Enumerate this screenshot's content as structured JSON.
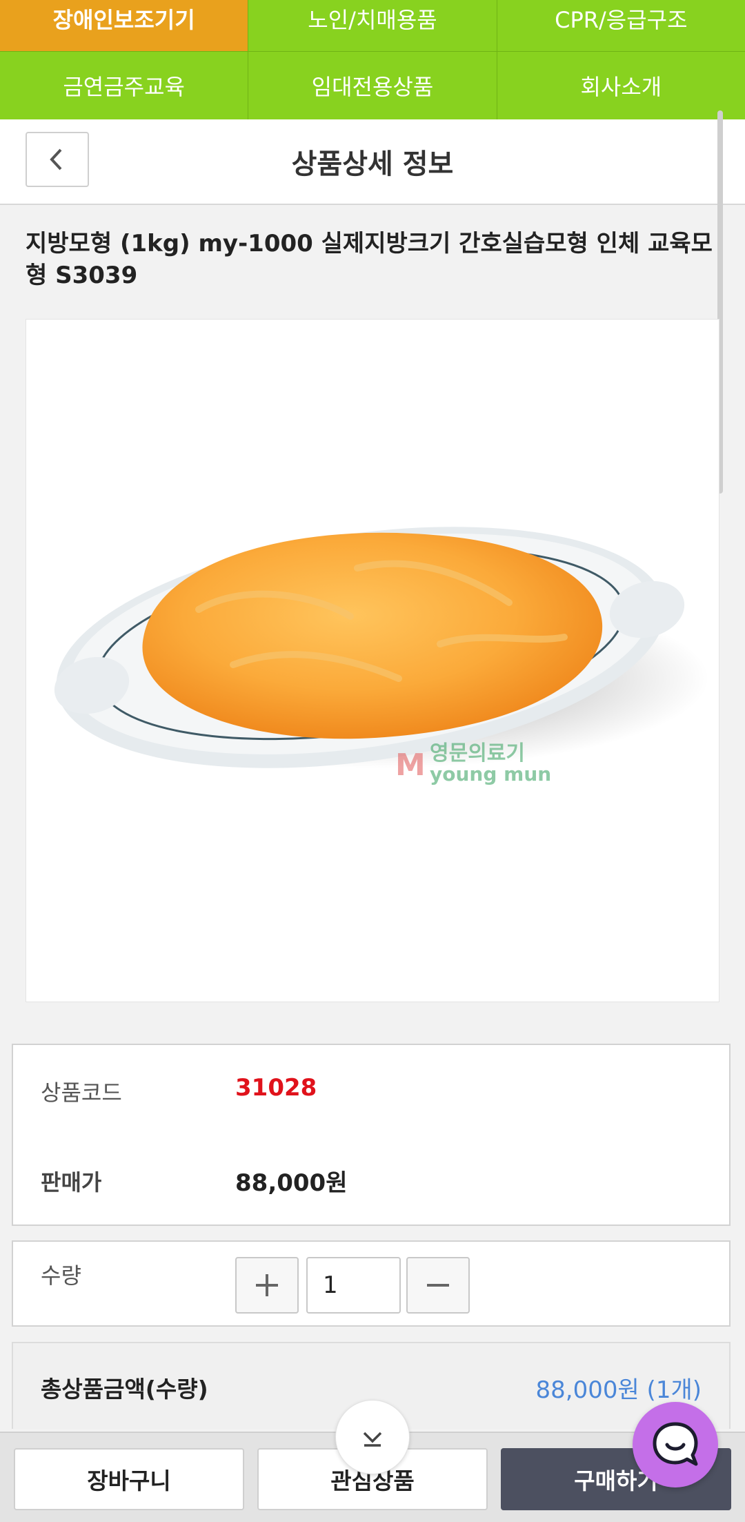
{
  "category_nav": {
    "row1": [
      "장애인보조기기",
      "노인/치매용품",
      "CPR/응급구조"
    ],
    "row2": [
      "금연금주교육",
      "임대전용상품",
      "회사소개"
    ],
    "colors": {
      "bar": "#88d21f",
      "active": "#e9a11d"
    }
  },
  "header": {
    "title": "상품상세 정보",
    "back_icon": "chevron-left-icon"
  },
  "product": {
    "title": "지방모형 (1kg) my-1000 실제지방크기 간호실습모형 인체 교육모형 S3039",
    "image_alt": "지방모형",
    "watermark_ko": "영문의료기",
    "watermark_en": "young mun",
    "watermark_logo": "M"
  },
  "info": {
    "code_label": "상품코드",
    "code_value": "31028",
    "price_label": "판매가",
    "price_value": "88,000원"
  },
  "quantity": {
    "label": "수량",
    "value": "1",
    "plus_icon": "plus-icon",
    "minus_icon": "minus-icon"
  },
  "total": {
    "label": "총상품금액(수량)",
    "value": "88,000원 (1개)"
  },
  "bottom_bar": {
    "cart": "장바구니",
    "wishlist": "관심상품",
    "buy": "구매하기"
  },
  "colors": {
    "code_red": "#e0121b",
    "total_blue": "#4a86d8",
    "buy_button": "#4c5060",
    "chat_button": "#c46fe8"
  }
}
